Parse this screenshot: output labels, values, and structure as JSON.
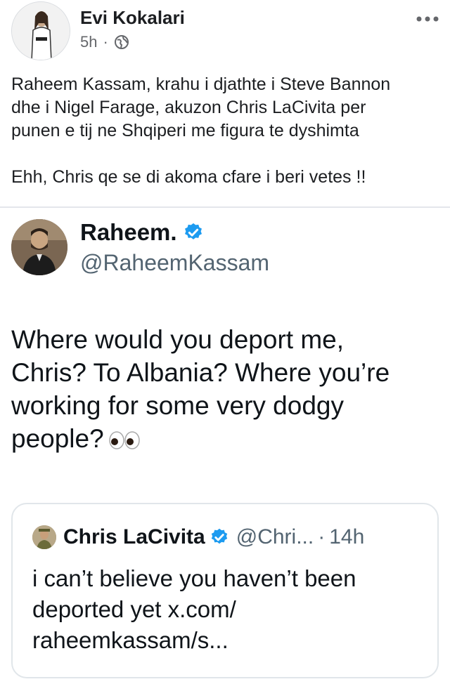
{
  "post": {
    "author": "Evi Kokalari",
    "time": "5h",
    "separator": "·",
    "text_lines": [
      "Raheem Kassam, krahu i djathte i Steve Bannon",
      "dhe i Nigel Farage, akuzon Chris LaCivita per",
      "punen e tij ne Shqiperi me figura te dyshimta"
    ],
    "text_2": "Ehh, Chris qe se di akoma cfare i beri vetes !!"
  },
  "tweet": {
    "name": "Raheem.",
    "handle": "@RaheemKassam",
    "body_lines": [
      "Where would you deport me,",
      "Chris? To Albania? Where you’re",
      "working for some very dodgy",
      "people?"
    ],
    "emoji": "eyes-icon"
  },
  "quote": {
    "name": "Chris LaCivita",
    "handle": "@Chri...",
    "separator": "·",
    "time": "14h",
    "body_lines": [
      "i can’t believe you haven’t been",
      "deported yet x.com/",
      "raheemkassam/s..."
    ]
  },
  "colors": {
    "verified": "#1d9bf0",
    "text": "#0f1419",
    "muted": "#536471"
  }
}
